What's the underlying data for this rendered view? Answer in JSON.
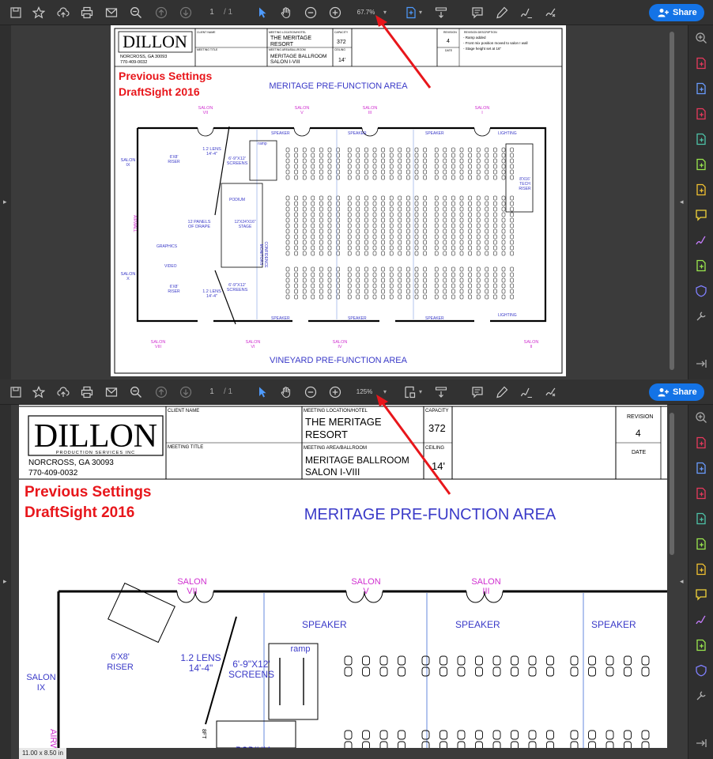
{
  "top_viewer": {
    "page_current": "1",
    "page_total": "/ 1",
    "zoom": "67.7%",
    "share_label": "Share"
  },
  "bottom_viewer": {
    "page_current": "1",
    "page_total": "/ 1",
    "zoom": "125%",
    "share_label": "Share",
    "page_size": "11.00 x 8.50 in"
  },
  "drawing": {
    "company": "DILLON",
    "company_sub": "PRODUCTION SERVICES INC",
    "city": "NORCROSS,  GA  30093",
    "phone": "770-409-0032",
    "client_name_label": "CLIENT NAME",
    "meeting_title_label": "MEETING TITLE",
    "location_label": "MEETING LOCATION/HOTEL",
    "location_value_1": "THE MERITAGE",
    "location_value_2": "RESORT",
    "area_label": "MEETING AREA/BALLROOM",
    "area_value_1": "MERITAGE  BALLROOM",
    "area_value_2": "SALON I-VIII",
    "capacity_label": "CAPACITY",
    "capacity_value": "372",
    "ceiling_label": "CEILING",
    "ceiling_value": "14'",
    "revision_label": "REVISION",
    "revision_value": "4",
    "revision_desc_label": "REVISION DESCRIPTION",
    "revision_notes": [
      "- Ramp added",
      "- Front mix position moved to salon I wall",
      "- Stage height set at 16\""
    ],
    "date_label": "DATE",
    "previous_line1": "Previous Settings",
    "previous_line2": "DraftSight 2016",
    "prefunction_top": "MERITAGE  PRE-FUNCTION  AREA",
    "prefunction_bottom": "VINEYARD  PRE-FUNCTION  AREA",
    "salon_top": [
      "SALON\nVII",
      "SALON\nV",
      "SALON\nIII",
      "SALON\nI"
    ],
    "salon_bottom": [
      "SALON\nVIII",
      "SALON\nVI",
      "SALON\nIV",
      "SALON\nII"
    ],
    "salon_ix": "SALON\nIX",
    "salon_x": "SALON\nX",
    "airwall": "AIRWALL",
    "speaker": "SPEAKER",
    "lighting": "LIGHTING",
    "riser": "6'X8'\nRISER",
    "lens": "1.2  LENS\n14'-4\"",
    "screens": "6'-9\"X12'\nSCREENS",
    "ramp": "ramp",
    "podium": "PODIUM",
    "panels": "12  PANELS\nOF  DRAPE",
    "stage": "12'X24'X16\"\nSTAGE",
    "confidence": "CONFIDENCE\nMONITORS",
    "graphics": "GRAPHICS",
    "video": "VIDEO",
    "tech_riser": "8'X16'\nTECH\nRISER",
    "sft": "8FT"
  },
  "colors": {
    "accent_blue": "#1473e6",
    "annotation_red": "#e8161b",
    "drawing_blue": "#3a3ac8",
    "drawing_magenta": "#d030d0"
  },
  "icons": {
    "toolbar": [
      "save-icon",
      "bookmark-star-icon",
      "cloud-upload-icon",
      "print-icon",
      "email-icon",
      "zoom-search-icon",
      "page-up-icon",
      "page-down-icon",
      "select-arrow-icon",
      "hand-pan-icon",
      "zoom-out-icon",
      "zoom-in-icon",
      "fit-page-icon",
      "scroll-mode-icon",
      "comment-icon",
      "highlight-pen-icon",
      "draw-sign-icon",
      "fill-sign-icon"
    ],
    "right_rail": [
      "zoom-icon",
      "export-pdf-icon",
      "combine-files-icon",
      "organize-pages-icon",
      "edit-pdf-icon",
      "compress-icon",
      "create-pdf-icon",
      "comment-tool-icon",
      "fill-sign-tool-icon",
      "print-production-icon",
      "protect-icon",
      "more-tools-icon",
      "expand-icon"
    ]
  }
}
